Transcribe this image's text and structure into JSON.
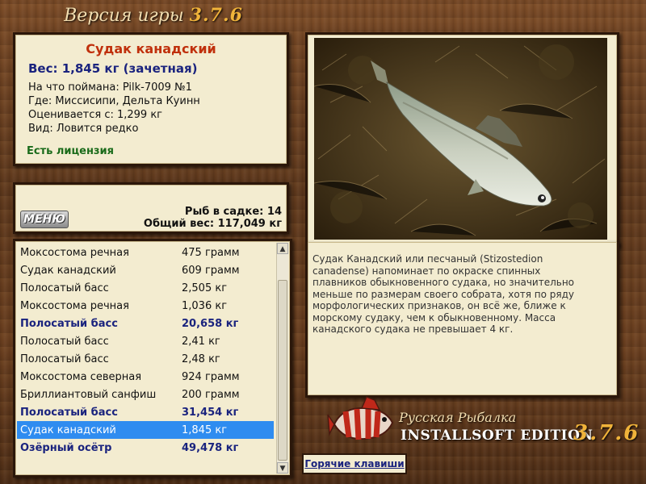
{
  "app": {
    "version_prefix": "Версия игры",
    "version_number": "3.7.6"
  },
  "fish_card": {
    "name": "Судак канадский",
    "weight_line": "Вес: 1,845 кг (зачетная)",
    "caught_on": "На что поймана: Pilk-7009 №1",
    "location": "Где: Миссисипи, Дельта Куинн",
    "valued_from": "Оценивается с: 1,299 кг",
    "species_note": "Вид: Ловится редко",
    "license": "Есть лицензия"
  },
  "cage": {
    "menu_label": "МЕНЮ",
    "fish_count": "Рыб в садке: 14",
    "total_weight": "Общий вес: 117,049 кг"
  },
  "catch_list": [
    {
      "name": "Моксостома речная",
      "weight": "475 грамм",
      "style": "normal"
    },
    {
      "name": "Судак канадский",
      "weight": "609 грамм",
      "style": "normal"
    },
    {
      "name": "Полосатый басс",
      "weight": "2,505 кг",
      "style": "normal"
    },
    {
      "name": "Моксостома речная",
      "weight": "1,036 кг",
      "style": "normal"
    },
    {
      "name": "Полосатый басс",
      "weight": "20,658 кг",
      "style": "bold"
    },
    {
      "name": "Полосатый басс",
      "weight": "2,41 кг",
      "style": "normal"
    },
    {
      "name": "Полосатый басс",
      "weight": "2,48 кг",
      "style": "normal"
    },
    {
      "name": "Моксостома северная",
      "weight": "924 грамм",
      "style": "normal"
    },
    {
      "name": "Бриллиантовый санфиш",
      "weight": "200 грамм",
      "style": "normal"
    },
    {
      "name": "Полосатый басс",
      "weight": "31,454 кг",
      "style": "bold"
    },
    {
      "name": "Судак канадский",
      "weight": "1,845 кг",
      "style": "selected"
    },
    {
      "name": "Озёрный осётр",
      "weight": "49,478 кг",
      "style": "bold"
    }
  ],
  "description": "Судак Канадский или песчаный (Stizostedion canadense) напоминает по окраске спинных плавников обыкновенного судака, но значительно меньше по размерам своего собрата, хотя по ряду морфологических признаков, он всё же, ближе к морскому судаку, чем к обыкновенному. Масса канадского судака не превышает 4 кг.",
  "hotkeys_label": "Горячие клавиши",
  "logo": {
    "title": "Русская Рыбалка",
    "edition": "INSTALLSOFT EDITION",
    "version": "3.7.6"
  },
  "colors": {
    "fish_name": "#c0300c",
    "weight_text": "#1a237e",
    "license_text": "#1a6b1a",
    "selected_row": "#2f8cf0",
    "panel_bg": "#f3ecd0",
    "version_accent": "#f0b33a"
  }
}
